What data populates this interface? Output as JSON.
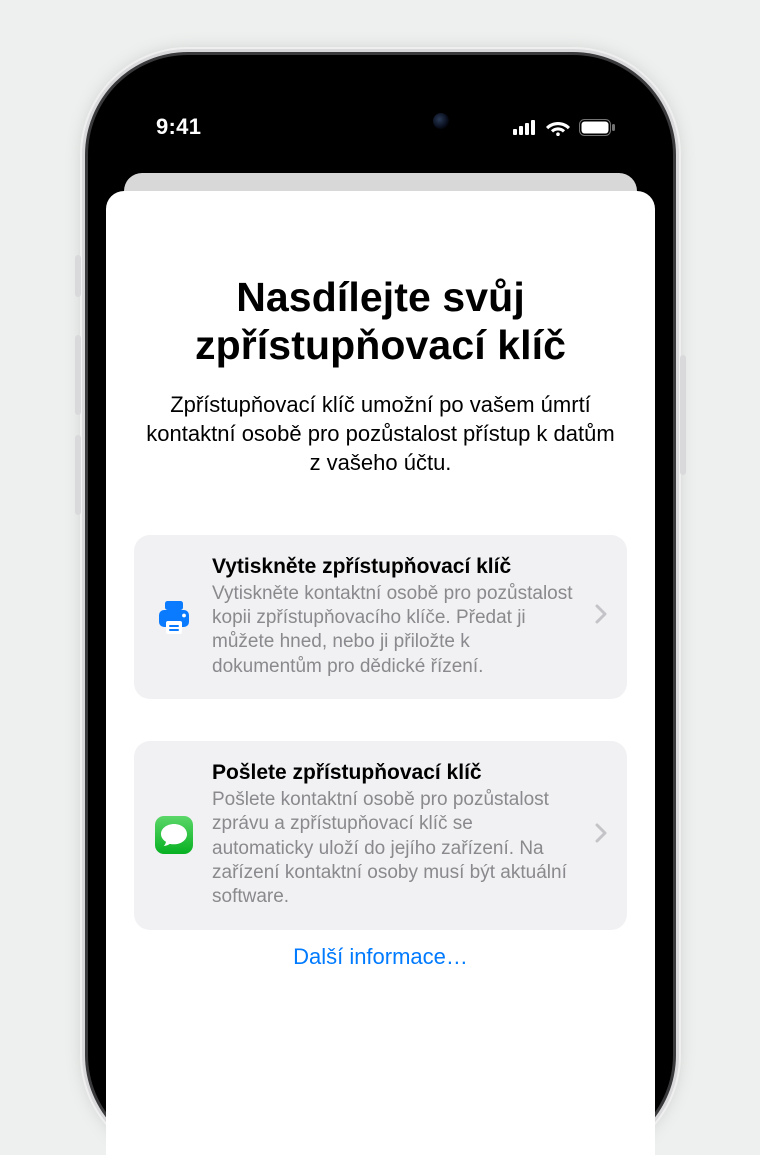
{
  "status": {
    "time": "9:41"
  },
  "sheet": {
    "title": "Nasdílejte svůj zpřístupňovací klíč",
    "description": "Zpřístupňovací klíč umožní po vašem úmrtí kontaktní osobě pro pozůstalost přístup k datům z vašeho účtu."
  },
  "options": {
    "print": {
      "title": "Vytiskněte zpřístupňovací klíč",
      "text": "Vytiskněte kontaktní osobě pro pozůstalost kopii zpřístupňovacího klíče. Předat ji můžete hned, nebo ji přiložte k dokumentům pro dědické řízení."
    },
    "send": {
      "title": "Pošlete zpřístupňovací klíč",
      "text": "Pošlete kontaktní osobě pro pozůstalost zprávu a zpřístupňovací klíč se automaticky uloží do jejího zařízení. Na zařízení kontaktní osoby musí být aktuální software."
    }
  },
  "more_link": "Další informace…"
}
